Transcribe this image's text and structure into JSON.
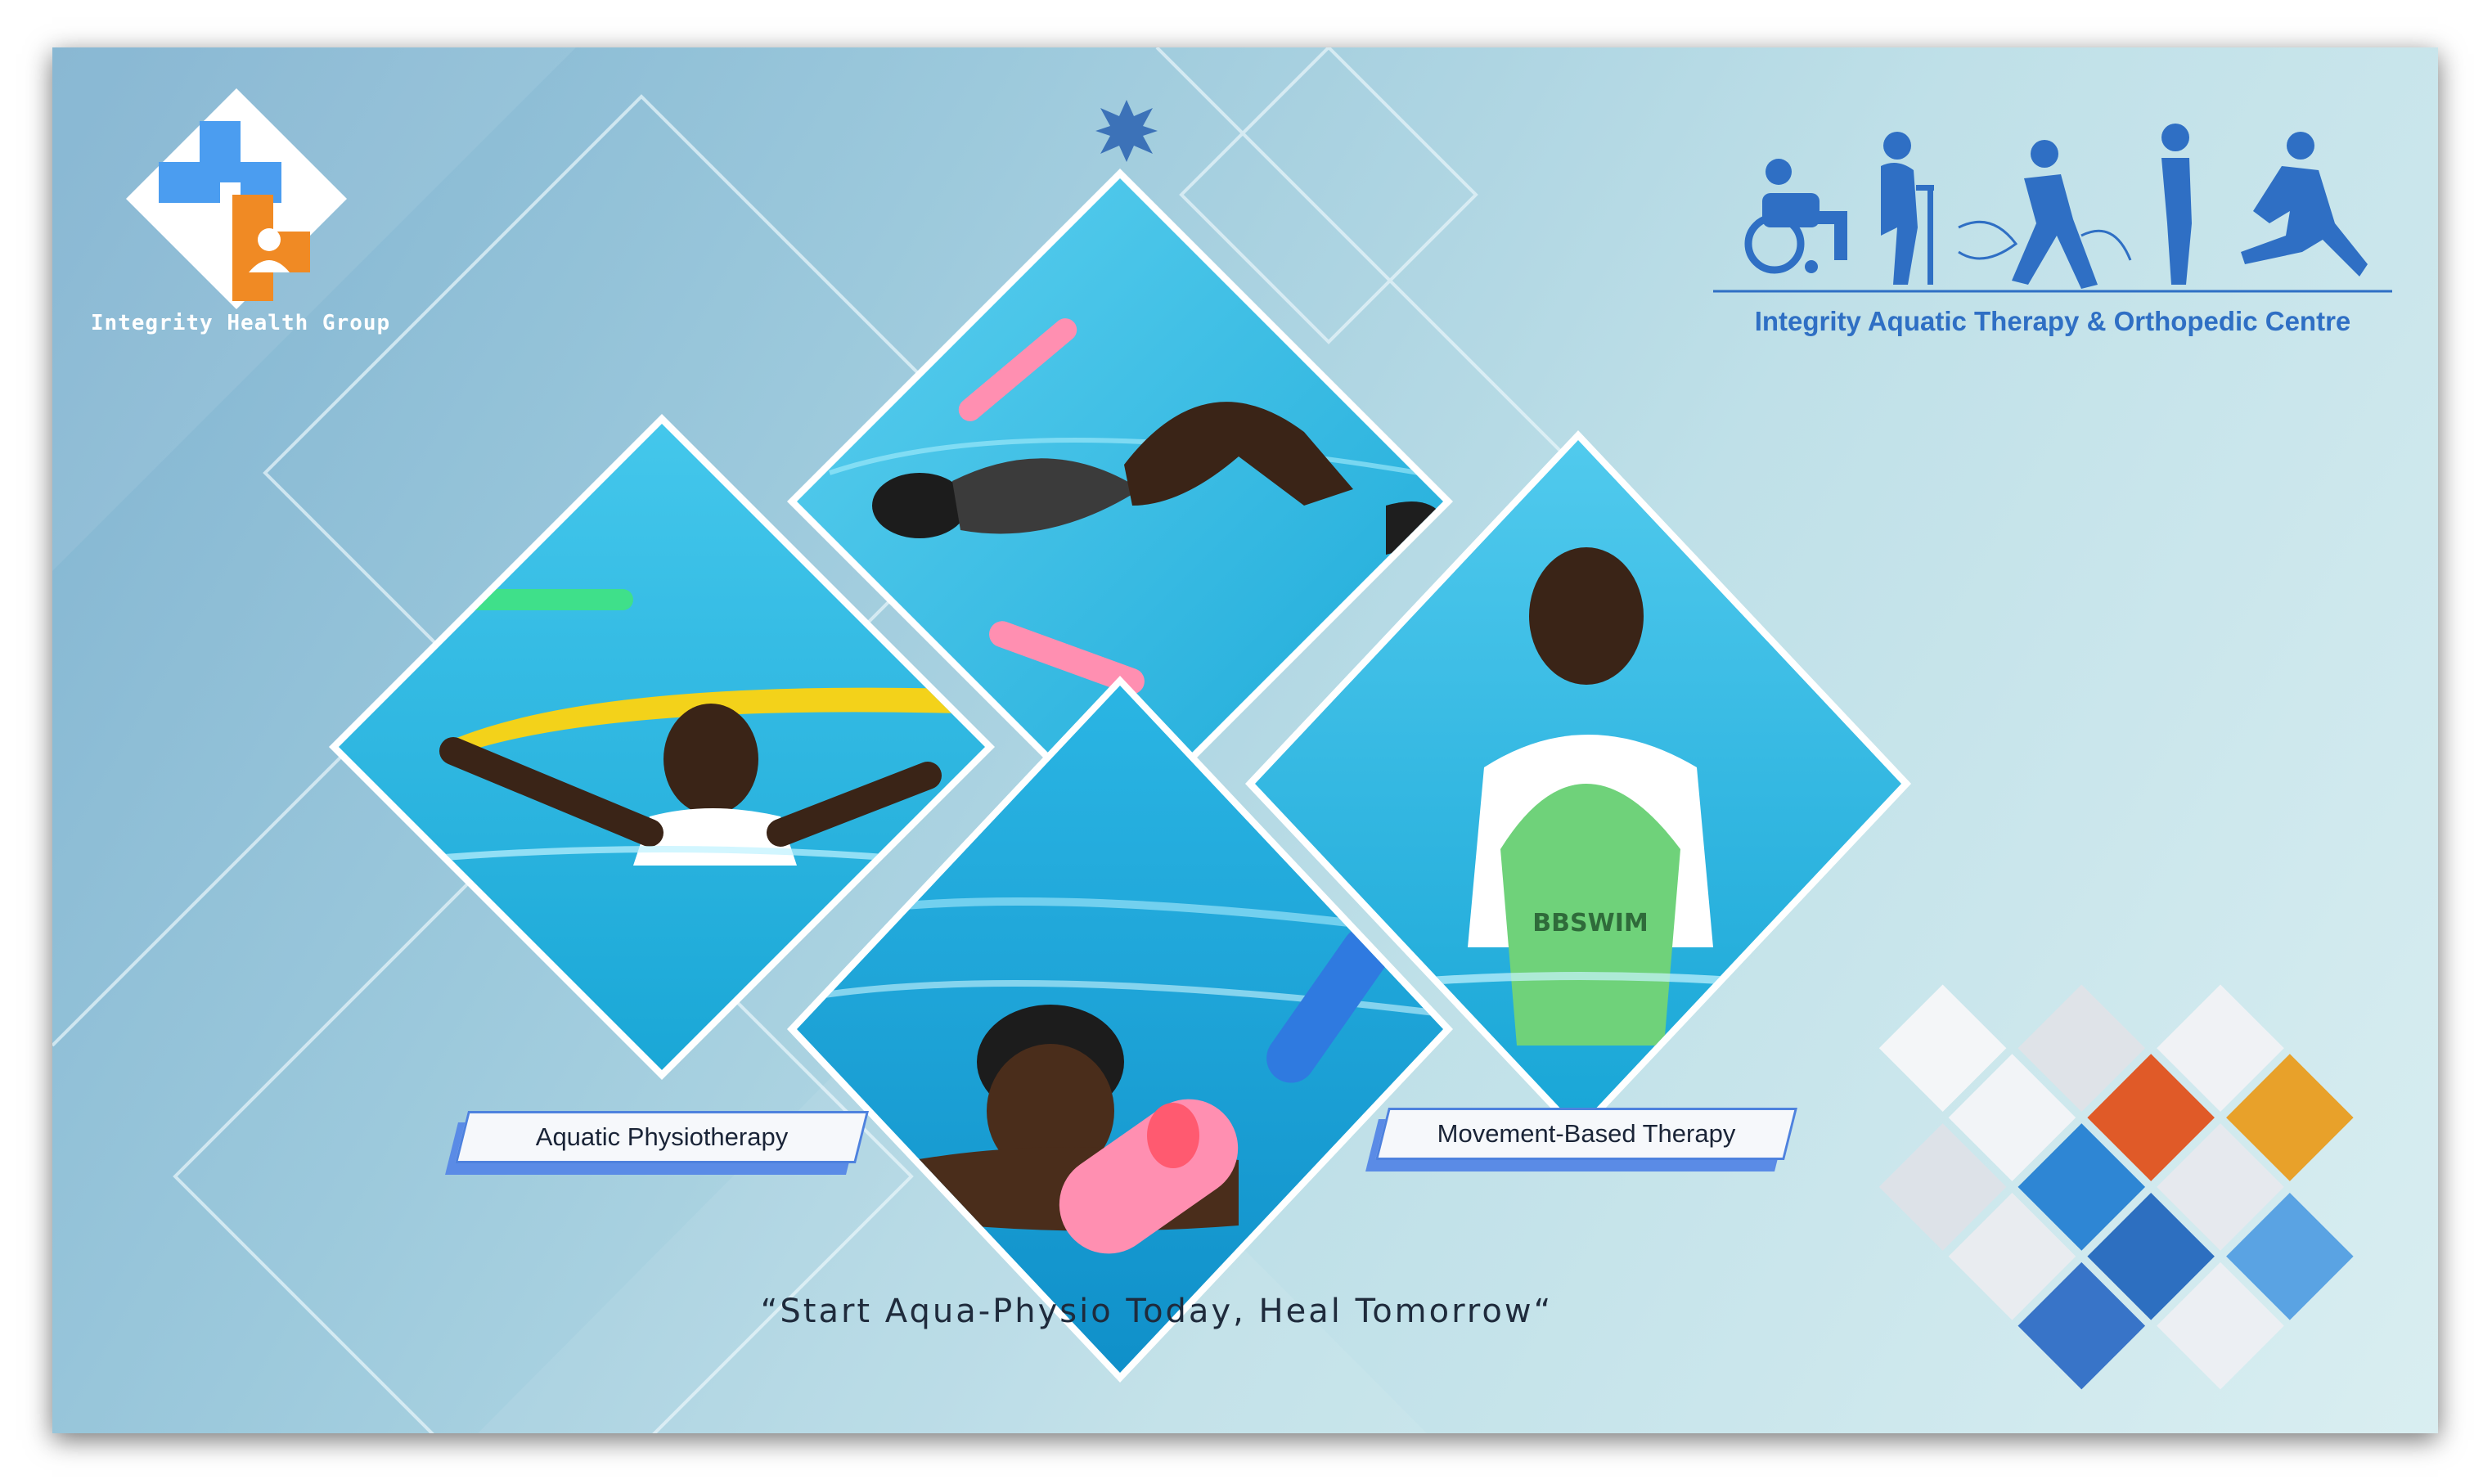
{
  "brand": {
    "group_name": "Integrity Health Group",
    "centre_name": "Integrity Aquatic Therapy & Orthopedic Centre"
  },
  "labels": {
    "left": "Aquatic Physiotherapy",
    "right": "Movement-Based Therapy"
  },
  "tagline": "“Start Aqua-Physio Today, Heal Tomorrow“",
  "photos": {
    "top": "photo of a woman floating on her back with pool noodles",
    "left": "photo of a woman holding a yellow pool noodle overhead",
    "bottom": "photo of a smiling woman swimming with a pink pool noodle",
    "right": "photo of a woman holding a green kickboard",
    "kickboard_text": "BBSWIM"
  },
  "colors": {
    "accent_blue": "#4e82de",
    "brand_blue": "#2f6fc4",
    "logo_blue": "#4b9df0",
    "logo_orange": "#f08a24",
    "water": "#22b8e0"
  },
  "icons": [
    "medical-cross-logo-icon",
    "rehab-progression-silhouette-icon",
    "star-ornament-icon"
  ]
}
